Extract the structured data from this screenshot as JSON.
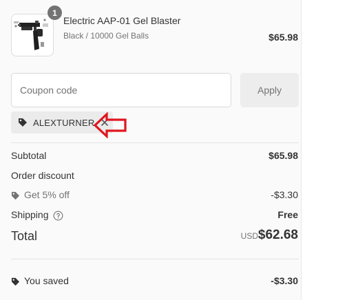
{
  "product": {
    "quantity": "1",
    "name": "Electric AAP-01 Gel Blaster",
    "variant": "Black / 10000 Gel Balls",
    "price": "$65.98",
    "image_icon": "gel-blaster-product-image"
  },
  "coupon": {
    "placeholder": "Coupon code",
    "apply_label": "Apply",
    "applied_code": "ALEXTURNER"
  },
  "summary": {
    "subtotal_label": "Subtotal",
    "subtotal_value": "$65.98",
    "order_discount_label": "Order discount",
    "discount_name": "Get 5% off",
    "discount_value": "-$3.30",
    "shipping_label": "Shipping",
    "shipping_value": "Free",
    "total_label": "Total",
    "total_currency": "USD",
    "total_value": "$62.68",
    "saved_label": "You saved",
    "saved_value": "-$3.30"
  },
  "colors": {
    "panel_bg": "#fafafa",
    "arrow_red": "#e0161e",
    "chip_bg": "#ebebeb",
    "button_bg": "#ededed"
  }
}
